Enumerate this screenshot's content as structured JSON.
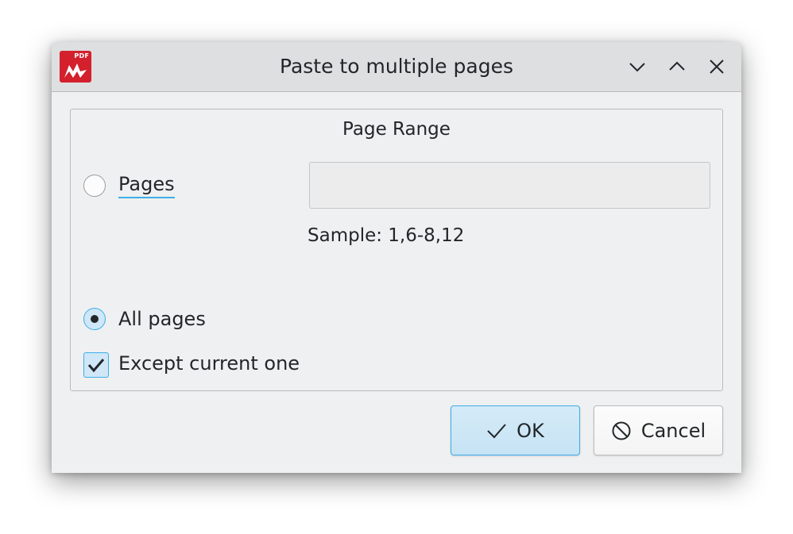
{
  "window": {
    "title": "Paste to multiple pages",
    "app_icon_text": "PDF"
  },
  "group": {
    "title": "Page Range",
    "pages_option_label": "Pages",
    "pages_input_value": "",
    "pages_input_placeholder": "",
    "sample_text": "Sample: 1,6-8,12",
    "all_pages_label": "All pages",
    "except_current_label": "Except current one",
    "pages_selected": false,
    "all_pages_selected": true,
    "except_current_checked": true
  },
  "buttons": {
    "ok_label": "OK",
    "cancel_label": "Cancel"
  },
  "colors": {
    "accent": "#3daee9",
    "app_red": "#d3202c",
    "window_bg": "#eff0f1",
    "titlebar_bg": "#dedfe0"
  }
}
